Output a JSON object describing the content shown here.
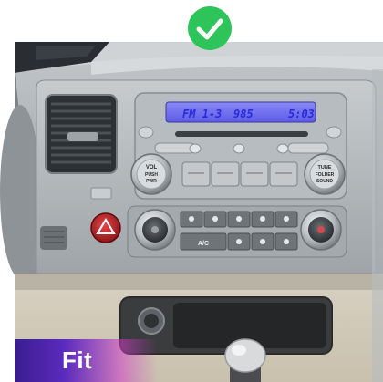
{
  "status": {
    "icon": "check-circle-icon",
    "color": "#2fc45a"
  },
  "radio_display": {
    "band": "FM 1-3",
    "frequency": "985",
    "time": "5:03",
    "backlight_color": "#6d6cf2"
  },
  "left_knob": {
    "line1": "VOL",
    "line2": "PUSH",
    "line3": "PWR"
  },
  "right_knob": {
    "line1": "TUNE",
    "line2": "FOLDER",
    "line3": "SOUND"
  },
  "climate": {
    "ac_label": "A/C"
  },
  "badge": {
    "label": "Fit"
  },
  "hazard_color": "#c8262b"
}
